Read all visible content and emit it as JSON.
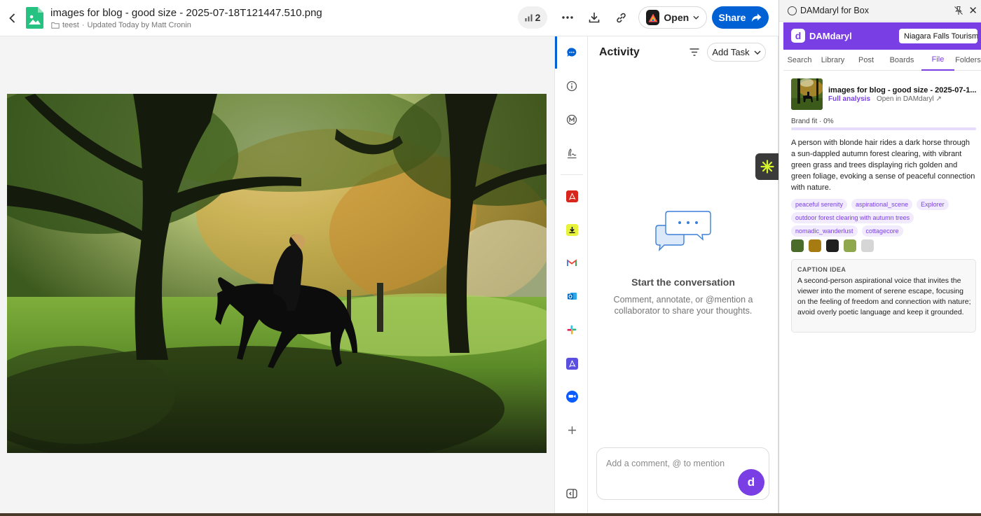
{
  "header": {
    "file_name": "images for blog - good size - 2025-07-18T121447.510.png",
    "folder": "teest",
    "updated": "Updated Today by Matt Cronin",
    "version_count": "2",
    "open_label": "Open",
    "share_label": "Share"
  },
  "preview": {
    "image_alt": "Person riding a dark horse through a sunlit autumn forest clearing"
  },
  "rail": {
    "icons": [
      "activity-icon",
      "info-icon",
      "metadata-icon",
      "sign-icon",
      "adobe-acrobat-app",
      "download-app",
      "gmail-app",
      "outlook-app",
      "slack-app",
      "adobe-sign-app",
      "zoom-app",
      "add-icon",
      "collapse-sidebar-icon"
    ]
  },
  "activity": {
    "title": "Activity",
    "add_task_label": "Add Task",
    "empty_title": "Start the conversation",
    "empty_body": "Comment, annotate, or @mention a collaborator to share your thoughts.",
    "comment_placeholder": "Add a comment, @ to mention",
    "avatar_letter": "d"
  },
  "extension": {
    "window_title": "DAMdaryl for Box",
    "brand_name": "DAMdaryl",
    "brand_logo_letter": "d",
    "brand_select": "Niagara Falls Tourism",
    "tabs": [
      {
        "label": "Search",
        "active": false
      },
      {
        "label": "Library",
        "active": false
      },
      {
        "label": "Post",
        "active": false
      },
      {
        "label": "Boards",
        "active": false
      },
      {
        "label": "File",
        "active": true
      },
      {
        "label": "Folders",
        "active": false
      }
    ],
    "file_name": "images for blog - good size - 2025-07-1...",
    "full_analysis": "Full analysis",
    "open_in": "Open in DAMdaryl ↗",
    "brand_fit_label": "Brand fit · 0%",
    "brand_fit_value": 0,
    "description": "A person with blonde hair rides a dark horse through a sun-dappled autumn forest clearing, with vibrant green grass and trees displaying rich golden and green foliage, evoking a sense of peaceful connection with nature.",
    "tags": [
      "peaceful serenity",
      "aspirational_scene",
      "Explorer",
      "outdoor forest clearing with autumn trees",
      "nomadic_wanderlust",
      "cottagecore"
    ],
    "palette": [
      "#4a6b2a",
      "#a67c12",
      "#1f1f1f",
      "#8fa84e",
      "#d6d6d6"
    ],
    "caption_label": "CAPTION IDEA",
    "caption_text": "A second-person aspirational voice that invites the viewer into the moment of serene escape, focusing on the feeling of freedom and connection with nature; avoid overly poetic language and keep it grounded."
  },
  "colors": {
    "box_blue": "#0061d5",
    "damdaryl_purple": "#7a3fe4"
  }
}
